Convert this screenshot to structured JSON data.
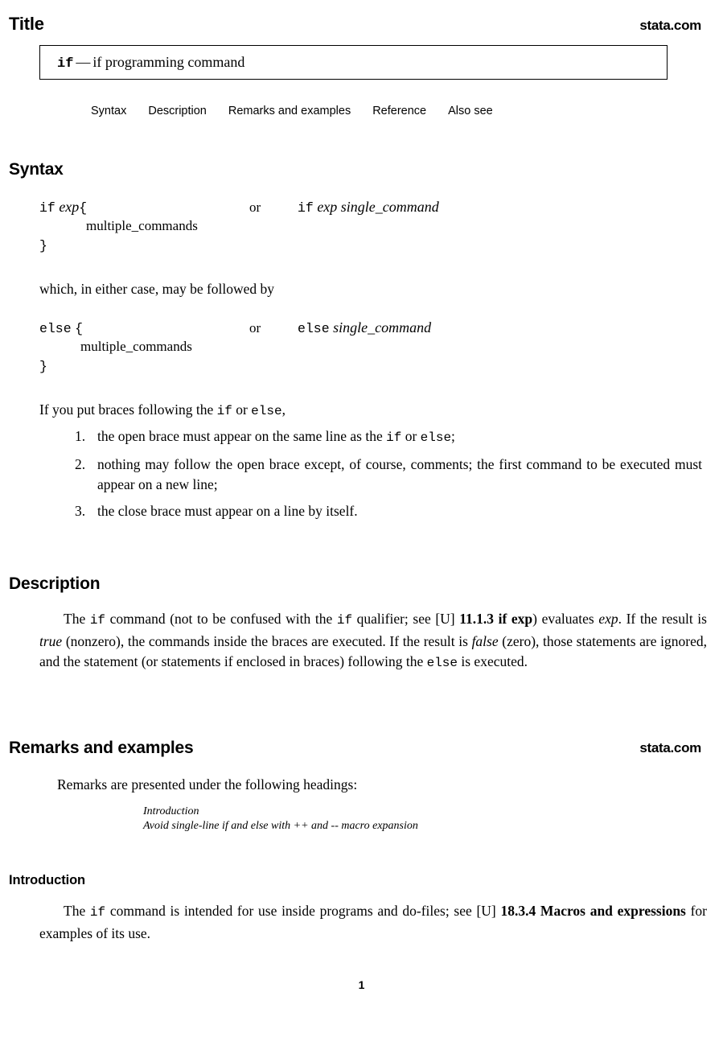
{
  "header": {
    "title": "Title",
    "site": "stata.com"
  },
  "title_box": {
    "command": "if",
    "dash": "—",
    "description": "if programming command"
  },
  "nav": {
    "items": [
      {
        "label": "Syntax"
      },
      {
        "label": "Description"
      },
      {
        "label": "Remarks and examples"
      },
      {
        "label": "Reference"
      },
      {
        "label": "Also see"
      }
    ]
  },
  "syntax": {
    "heading": "Syntax",
    "if_block": {
      "line1_cmd": "if",
      "line1_exp": "exp",
      "line1_brace": "{",
      "line2_multiple": "multiple_commands",
      "line3_brace": "}",
      "or": "or",
      "alt_cmd": "if",
      "alt_exp": "exp",
      "alt_single": "single_command"
    },
    "which_line": "which, in either case, may be followed by",
    "else_block": {
      "line1_cmd": "else",
      "line1_brace": "{",
      "line2_multiple": "multiple_commands",
      "line3_brace": "}",
      "or": "or",
      "alt_cmd": "else",
      "alt_single": "single_command"
    },
    "braces_intro_1": "If you put braces following the ",
    "braces_intro_if": "if",
    "braces_intro_2": " or ",
    "braces_intro_else": "else",
    "braces_intro_3": ",",
    "rules": [
      {
        "num": "1.",
        "text_1": "the open brace must appear on the same line as the ",
        "mono_1": "if",
        "text_2": " or ",
        "mono_2": "else",
        "text_3": ";"
      },
      {
        "num": "2.",
        "text_1": "nothing may follow the open brace except, of course, comments; the first command to be executed must appear on a new line;",
        "mono_1": "",
        "text_2": "",
        "mono_2": "",
        "text_3": ""
      },
      {
        "num": "3.",
        "text_1": "the close brace must appear on a line by itself.",
        "mono_1": "",
        "text_2": "",
        "mono_2": "",
        "text_3": ""
      }
    ]
  },
  "description": {
    "heading": "Description",
    "p1_a": "The ",
    "p1_mono1": "if",
    "p1_b": " command (not to be confused with the ",
    "p1_mono2": "if",
    "p1_c": " qualifier; see [U] ",
    "p1_bold1": "11.1.3 if exp",
    "p1_d": ") evaluates ",
    "p1_ital1": "exp",
    "p1_e": ". If the result is ",
    "p1_ital2": "true",
    "p1_f": " (nonzero), the commands inside the braces are executed. If the result is ",
    "p1_ital3": "false",
    "p1_g": " (zero), those statements are ignored, and the statement (or statements if enclosed in braces) following the ",
    "p1_mono3": "else",
    "p1_h": " is executed."
  },
  "remarks": {
    "heading": "Remarks and examples",
    "site": "stata.com",
    "intro_line": "Remarks are presented under the following headings:",
    "toc": [
      "Introduction",
      "Avoid single-line if and else with ++ and -- macro expansion"
    ]
  },
  "introduction": {
    "heading": "Introduction",
    "p1_a": "The ",
    "p1_mono1": "if",
    "p1_b": " command is intended for use inside programs and do-files; see [U] ",
    "p1_bold1": "18.3.4 Macros and expressions",
    "p1_c": " for examples of its use."
  },
  "footer": {
    "page_number": "1"
  }
}
